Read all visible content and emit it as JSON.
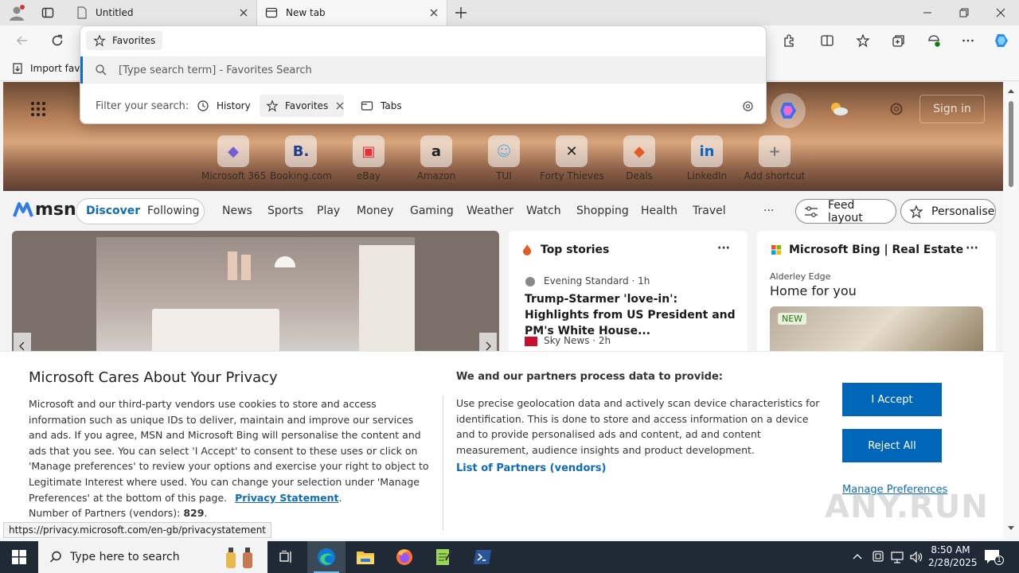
{
  "browser": {
    "tabs": [
      {
        "title": "Untitled",
        "icon": "page-icon",
        "active": false
      },
      {
        "title": "New tab",
        "icon": "newtab-icon",
        "active": true
      }
    ],
    "favorites_bar": {
      "import_label": "Import favo"
    }
  },
  "favorites_dropdown": {
    "chip_label": "Favorites",
    "search_placeholder": "[Type search term] - Favorites Search",
    "filter_label": "Filter your search:",
    "filters": [
      "History",
      "Favorites",
      "Tabs"
    ]
  },
  "newtab": {
    "sign_in": "Sign in",
    "shortcuts": [
      {
        "label": "Microsoft 365",
        "color": "#7a5bd6",
        "glyph": "◆"
      },
      {
        "label": "Booking.com",
        "color": "#1e3f8b",
        "glyph": "B."
      },
      {
        "label": "eBay",
        "color": "#e53238",
        "glyph": "▣"
      },
      {
        "label": "Amazon",
        "color": "#222222",
        "glyph": "a"
      },
      {
        "label": "TUI",
        "color": "#63b0e3",
        "glyph": "☺"
      },
      {
        "label": "Forty Thieves",
        "color": "#222222",
        "glyph": "✕"
      },
      {
        "label": "Deals",
        "color": "#e35a24",
        "glyph": "◆"
      },
      {
        "label": "LinkedIn",
        "color": "#0a66c2",
        "glyph": "in"
      },
      {
        "label": "Add shortcut",
        "color": "#777777",
        "glyph": "+"
      }
    ],
    "msn": {
      "logo": "msn",
      "tabs": [
        "Discover",
        "Following"
      ],
      "nav": [
        "News",
        "Sports",
        "Play",
        "Money",
        "Gaming",
        "Weather",
        "Watch",
        "Shopping",
        "Health",
        "Travel"
      ],
      "more": "···",
      "feed_layout": "Feed layout",
      "personalise": "Personalise"
    },
    "top_stories": {
      "title": "Top stories",
      "more": "···",
      "items": [
        {
          "source": "Evening Standard · 1h",
          "headline": "Trump-Starmer 'love-in': Highlights from US President and PM's White House..."
        },
        {
          "source": "Sky News · 2h",
          "headline": ""
        }
      ]
    },
    "bing_card": {
      "title": "Microsoft Bing | Real Estate",
      "more": "···",
      "location": "Alderley Edge",
      "heading": "Home for you",
      "badge": "NEW"
    }
  },
  "privacy": {
    "title": "Microsoft Cares About Your Privacy",
    "body": "Microsoft and our third-party vendors use cookies to store and access information such as unique IDs to deliver, maintain and improve our services and ads. If you agree, MSN and Microsoft Bing will personalise the content and ads that you see. You can select 'I Accept' to consent to these uses or click on 'Manage preferences' to review your options and exercise your right to object to Legitimate Interest where used.  You can change your selection under 'Manage Preferences' at the bottom of this page.",
    "privacy_link": "Privacy Statement",
    "partners_label": "Number of Partners (vendors):",
    "partners_count": "829",
    "right_title": "We and our partners process data to provide:",
    "right_body": "Use precise geolocation data and actively scan device characteristics for identification. This is done to store and access information on a device and to provide personalised ads and content, ad and content measurement, audience insights and product development.",
    "vendors_link": "List of Partners (vendors)",
    "accept": "I Accept",
    "reject": "Reject All",
    "manage": "Manage Preferences"
  },
  "status_url": "https://privacy.microsoft.com/en-gb/privacystatement",
  "taskbar": {
    "search_placeholder": "Type here to search",
    "time": "8:50 AM",
    "date": "2/28/2025",
    "notification_count": "1"
  },
  "watermark": "ANY.RUN",
  "colors": {
    "accent": "#0f6cbd",
    "button": "#0067b8",
    "taskbar": "#1f2a36"
  }
}
